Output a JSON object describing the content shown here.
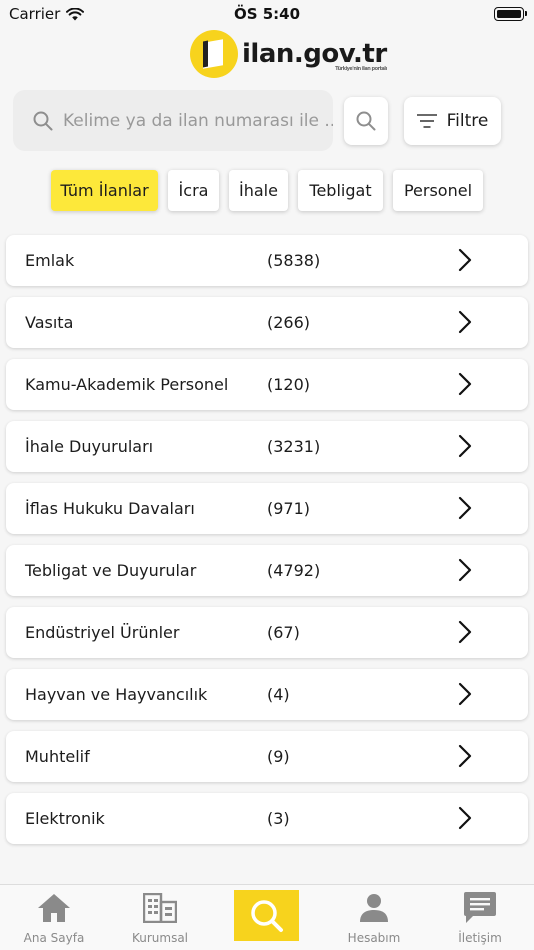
{
  "status_bar": {
    "carrier": "Carrier",
    "time": "ÖS 5:40"
  },
  "logo": {
    "text": "ilan.gov.tr",
    "tagline": "Türkiye'nin ilan portalı"
  },
  "search": {
    "placeholder": "Kelime ya da ilan numarası ile ...",
    "value": ""
  },
  "filter": {
    "label": "Filtre"
  },
  "tabs": [
    {
      "label": "Tüm İlanlar",
      "active": true
    },
    {
      "label": "İcra"
    },
    {
      "label": "İhale"
    },
    {
      "label": "Tebligat"
    },
    {
      "label": "Personel"
    }
  ],
  "categories": [
    {
      "name": "Emlak",
      "count": "(5838)"
    },
    {
      "name": "Vasıta",
      "count": "(266)"
    },
    {
      "name": "Kamu-Akademik Personel",
      "count": "(120)"
    },
    {
      "name": "İhale Duyuruları",
      "count": "(3231)"
    },
    {
      "name": "İflas Hukuku Davaları",
      "count": "(971)"
    },
    {
      "name": "Tebligat ve Duyurular",
      "count": "(4792)"
    },
    {
      "name": "Endüstriyel Ürünler",
      "count": "(67)"
    },
    {
      "name": "Hayvan ve Hayvancılık",
      "count": "(4)"
    },
    {
      "name": "Muhtelif",
      "count": "(9)"
    },
    {
      "name": "Elektronik",
      "count": "(3)"
    }
  ],
  "bottom_nav": [
    {
      "label": "Ana Sayfa",
      "icon": "home-icon"
    },
    {
      "label": "Kurumsal",
      "icon": "building-icon"
    },
    {
      "label": "",
      "icon": "search-icon",
      "active": true
    },
    {
      "label": "Hesabım",
      "icon": "person-icon"
    },
    {
      "label": "İletişim",
      "icon": "chat-icon"
    }
  ],
  "colors": {
    "accent": "#f7d31d",
    "tab_active": "#fde83a",
    "background": "#f6f6f6",
    "nav_icon": "#8a8a8a"
  }
}
